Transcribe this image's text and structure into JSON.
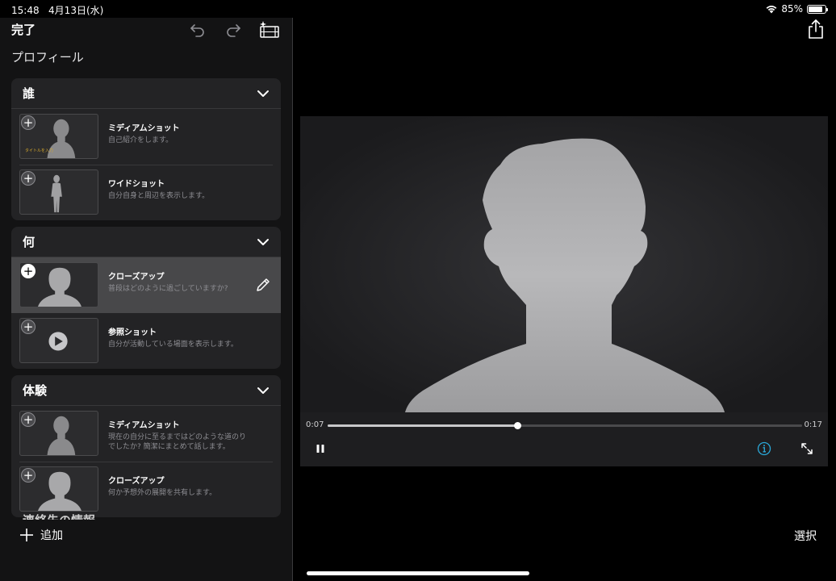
{
  "status_bar": {
    "time": "15:48",
    "date": "4月13日(水)",
    "battery_percent": "85%",
    "battery_level": 0.85
  },
  "toolbar": {
    "done_label": "完了",
    "undo_icon": "undo-icon",
    "redo_icon": "redo-icon",
    "movie_icon": "sparkle-film-icon"
  },
  "profile_title": "プロフィール",
  "sections": [
    {
      "title": "誰",
      "rows": [
        {
          "title": "ミディアムショット",
          "subtitle": "自己紹介をします。",
          "thumb_caption": "タイトルを入力"
        },
        {
          "title": "ワイドショット",
          "subtitle": "自分自身と周辺を表示します。"
        }
      ]
    },
    {
      "title": "何",
      "rows": [
        {
          "title": "クローズアップ",
          "subtitle": "普段はどのように過ごしていますか?"
        },
        {
          "title": "参照ショット",
          "subtitle": "自分が活動している場面を表示します。"
        }
      ]
    },
    {
      "title": "体験",
      "rows": [
        {
          "title": "ミディアムショット",
          "subtitle": "現在の自分に至るまではどのような道のりでしたか? 簡潔にまとめて話します。"
        },
        {
          "title": "クローズアップ",
          "subtitle": "何か予想外の展開を共有します。"
        }
      ]
    }
  ],
  "partial_section_title": "連絡先の情報",
  "bottom_bar": {
    "add_label": "追加",
    "select_label": "選択"
  },
  "player": {
    "current_time": "0:07",
    "total_time": "0:17",
    "progress": 0.4
  },
  "colors": {
    "accent": "#2aa8d8",
    "caption": "#d4a72c"
  }
}
